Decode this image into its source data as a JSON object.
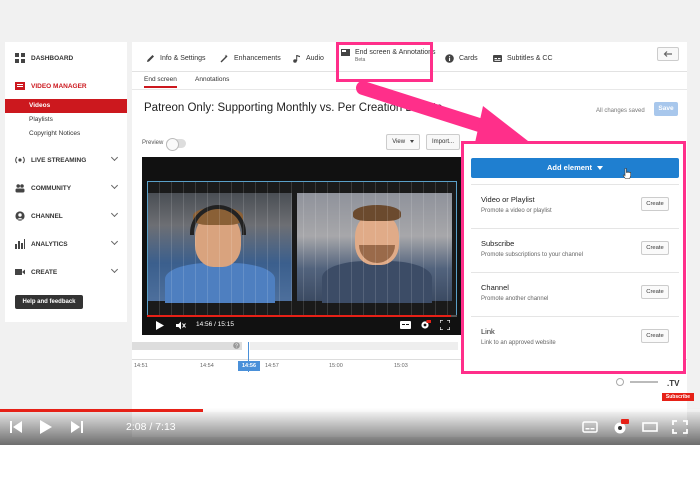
{
  "sidebar": {
    "dashboard": "DASHBOARD",
    "video_manager": "VIDEO MANAGER",
    "sub_items": [
      "Videos",
      "Playlists",
      "Copyright Notices"
    ],
    "live_streaming": "LIVE STREAMING",
    "community": "COMMUNITY",
    "channel": "CHANNEL",
    "analytics": "ANALYTICS",
    "create": "CREATE",
    "help": "Help and feedback"
  },
  "tabs": {
    "info": "Info & Settings",
    "enhancements": "Enhancements",
    "audio": "Audio",
    "end_screen": "End screen & Annotations",
    "end_screen_badge": "Beta",
    "cards": "Cards",
    "subtitles": "Subtitles & CC"
  },
  "subtabs": {
    "end_screen": "End screen",
    "annotations": "Annotations"
  },
  "video": {
    "title": "Patreon Only: Supporting Monthly vs. Per Creation Debate",
    "saved_status": "All changes saved",
    "save_label": "Save",
    "preview_label": "Preview",
    "view_label": "View",
    "import_label": "Import...",
    "player_time": "14:56 / 15:15",
    "player_progress": 0.98
  },
  "timeline": {
    "ticks": [
      "14:51",
      "14:54",
      "14:57",
      "15:00",
      "15:03"
    ],
    "current": "14:56"
  },
  "add_element": {
    "button_label": "Add element",
    "options": [
      {
        "title": "Video or Playlist",
        "desc": "Promote a video or playlist",
        "btn": "Create"
      },
      {
        "title": "Subscribe",
        "desc": "Promote subscriptions to your channel",
        "btn": "Create"
      },
      {
        "title": "Channel",
        "desc": "Promote another channel",
        "btn": "Create"
      },
      {
        "title": "Link",
        "desc": "Link to an approved website",
        "btn": "Create"
      }
    ]
  },
  "branding": {
    "tv": ".TV",
    "subscribe": "Subscribe"
  },
  "outer_player": {
    "time": "2:08 / 7:13",
    "progress": 0.29
  },
  "colors": {
    "highlight": "#ff2f8a",
    "accent_red": "#cc181e",
    "accent_blue": "#1f7fd0"
  }
}
